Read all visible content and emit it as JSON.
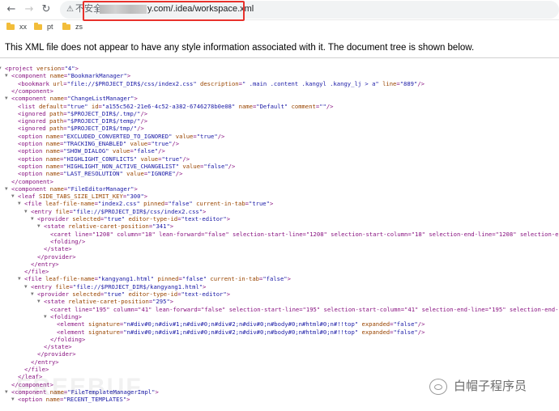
{
  "browser": {
    "insecure_label": "不安全",
    "url_visible": "y.com/.idea/workspace.xml",
    "back_icon": "arrow-left",
    "forward_icon": "arrow-right",
    "reload_icon": "reload",
    "warning_icon": "warning-triangle",
    "bookmarks": [
      "xx",
      "pt",
      "zs"
    ]
  },
  "xml_notice": "This XML file does not appear to have any style information associated with it. The document tree is shown below.",
  "xml_lines": [
    "<project version=\"4\">",
    "<component name=\"BookmarkManager\">",
    "<bookmark url=\"file://$PROJECT_DIR$/css/index2.css\" description=\" .main .content .kangyl .kangy_lj > a\" line=\"889\"/>",
    "</component>",
    "<component name=\"ChangeListManager\">",
    "<list default=\"true\" id=\"a155c562-21e6-4c52-a382-6746278b0e08\" name=\"Default\" comment=\"\"/>",
    "<ignored path=\"$PROJECT_DIR$/.tmp/\"/>",
    "<ignored path=\"$PROJECT_DIR$/temp/\"/>",
    "<ignored path=\"$PROJECT_DIR$/tmp/\"/>",
    "<option name=\"EXCLUDED_CONVERTED_TO_IGNORED\" value=\"true\"/>",
    "<option name=\"TRACKING_ENABLED\" value=\"true\"/>",
    "<option name=\"SHOW_DIALOG\" value=\"false\"/>",
    "<option name=\"HIGHLIGHT_CONFLICTS\" value=\"true\"/>",
    "<option name=\"HIGHLIGHT_NON_ACTIVE_CHANGELIST\" value=\"false\"/>",
    "<option name=\"LAST_RESOLUTION\" value=\"IGNORE\"/>",
    "</component>",
    "<component name=\"FileEditorManager\">",
    "<leaf SIDE_TABS_SIZE_LIMIT_KEY=\"300\">",
    "<file leaf-file-name=\"index2.css\" pinned=\"false\" current-in-tab=\"true\">",
    "<entry file=\"file://$PROJECT_DIR$/css/index2.css\">",
    "<provider selected=\"true\" editor-type-id=\"text-editor\">",
    "<state relative-caret-position=\"341\">",
    "<caret line=\"1208\" column=\"18\" lean-forward=\"false\" selection-start-line=\"1208\" selection-start-column=\"18\" selection-end-line=\"1208\" selection-end",
    "<folding/>",
    "</state>",
    "</provider>",
    "</entry>",
    "</file>",
    "<file leaf-file-name=\"kangyang1.html\" pinned=\"false\" current-in-tab=\"false\">",
    "<entry file=\"file://$PROJECT_DIR$/kangyang1.html\">",
    "<provider selected=\"true\" editor-type-id=\"text-editor\">",
    "<state relative-caret-position=\"295\">",
    "<caret line=\"195\" column=\"41\" lean-forward=\"false\" selection-start-line=\"195\" selection-start-column=\"41\" selection-end-line=\"195\" selection-end-co",
    "<folding>",
    "<element signature=\"n#div#0;n#div#1;n#div#0;n#div#2;n#div#0;n#body#0;n#html#0;n#!!top\" expanded=\"false\"/>",
    "<element signature=\"n#div#0;n#div#1;n#div#0;n#div#2;n#div#0;n#body#0;n#html#0;n#!!top\" expanded=\"false\"/>",
    "</folding>",
    "</state>",
    "</provider>",
    "</entry>",
    "</file>",
    "</leaf>",
    "</component>",
    "<component name=\"FileTemplateManagerImpl\">",
    "<option name=\"RECENT_TEMPLATES\">"
  ],
  "watermark": {
    "text": "白帽子程序员",
    "icon": "wechat-icon",
    "ghost_text": "FREEBUF"
  },
  "colors": {
    "tag": "#881280",
    "attr_name": "#994500",
    "attr_value": "#1a1aa6",
    "highlight_box": "#e8312b"
  }
}
